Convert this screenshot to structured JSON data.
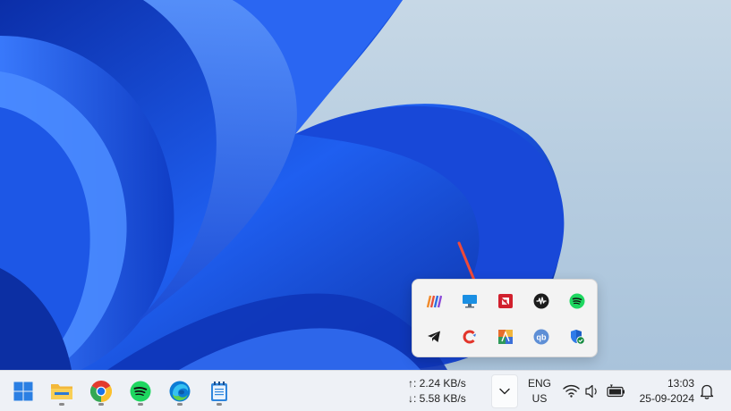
{
  "taskbar": {
    "apps": [
      {
        "name": "Start",
        "icon": "windows-start-icon"
      },
      {
        "name": "File Explorer",
        "icon": "folder-icon"
      },
      {
        "name": "Google Chrome",
        "icon": "chrome-icon"
      },
      {
        "name": "Spotify",
        "icon": "spotify-icon"
      },
      {
        "name": "Microsoft Edge",
        "icon": "edge-icon"
      },
      {
        "name": "Notepad",
        "icon": "notepad-icon"
      }
    ],
    "net_speed": {
      "upload": "↑: 2.24 KB/s",
      "download": "↓: 5.58 KB/s"
    },
    "language": {
      "line1": "ENG",
      "line2": "US"
    },
    "clock": {
      "time": "13:03",
      "date": "25-09-2024"
    }
  },
  "tray_flyout": {
    "icons": [
      "vivaldi-like-stripes-icon",
      "monitor-icon",
      "amd-icon",
      "audio-waveform-icon",
      "spotify-icon",
      "telegram-icon",
      "ccleaner-icon",
      "avast-icon",
      "qbittorrent-icon",
      "windows-security-icon"
    ]
  },
  "colors": {
    "accent_blue": "#1a57d6",
    "arrow_red": "#ee4a3a",
    "taskbar_bg": "#eef1f6"
  }
}
